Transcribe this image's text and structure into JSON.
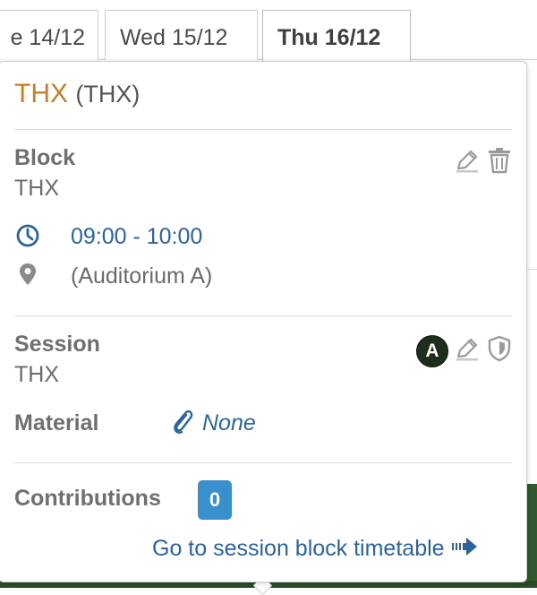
{
  "tabs": [
    {
      "label": "e 14/12"
    },
    {
      "label": "Wed 15/12"
    },
    {
      "label": "Thu 16/12"
    }
  ],
  "popup": {
    "title": "THX",
    "title_code": "(THX)",
    "block": {
      "label": "Block",
      "value": "THX",
      "time": "09:00 - 10:00",
      "location": "(Auditorium A)"
    },
    "session": {
      "label": "Session",
      "value": "THX",
      "badge_letter": "A",
      "material_label": "Material",
      "material_value": "None"
    },
    "contributions": {
      "label": "Contributions",
      "count": "0"
    },
    "footer_link": "Go to session block timetable"
  },
  "colors": {
    "title_accent": "#c77d27",
    "link": "#2a64a0",
    "count_badge": "#3a8fcf"
  },
  "icons": [
    "pencil-icon",
    "trash-icon",
    "clock-icon",
    "map-pin-icon",
    "shield-icon",
    "paperclip-icon",
    "arrow-right-icon"
  ]
}
